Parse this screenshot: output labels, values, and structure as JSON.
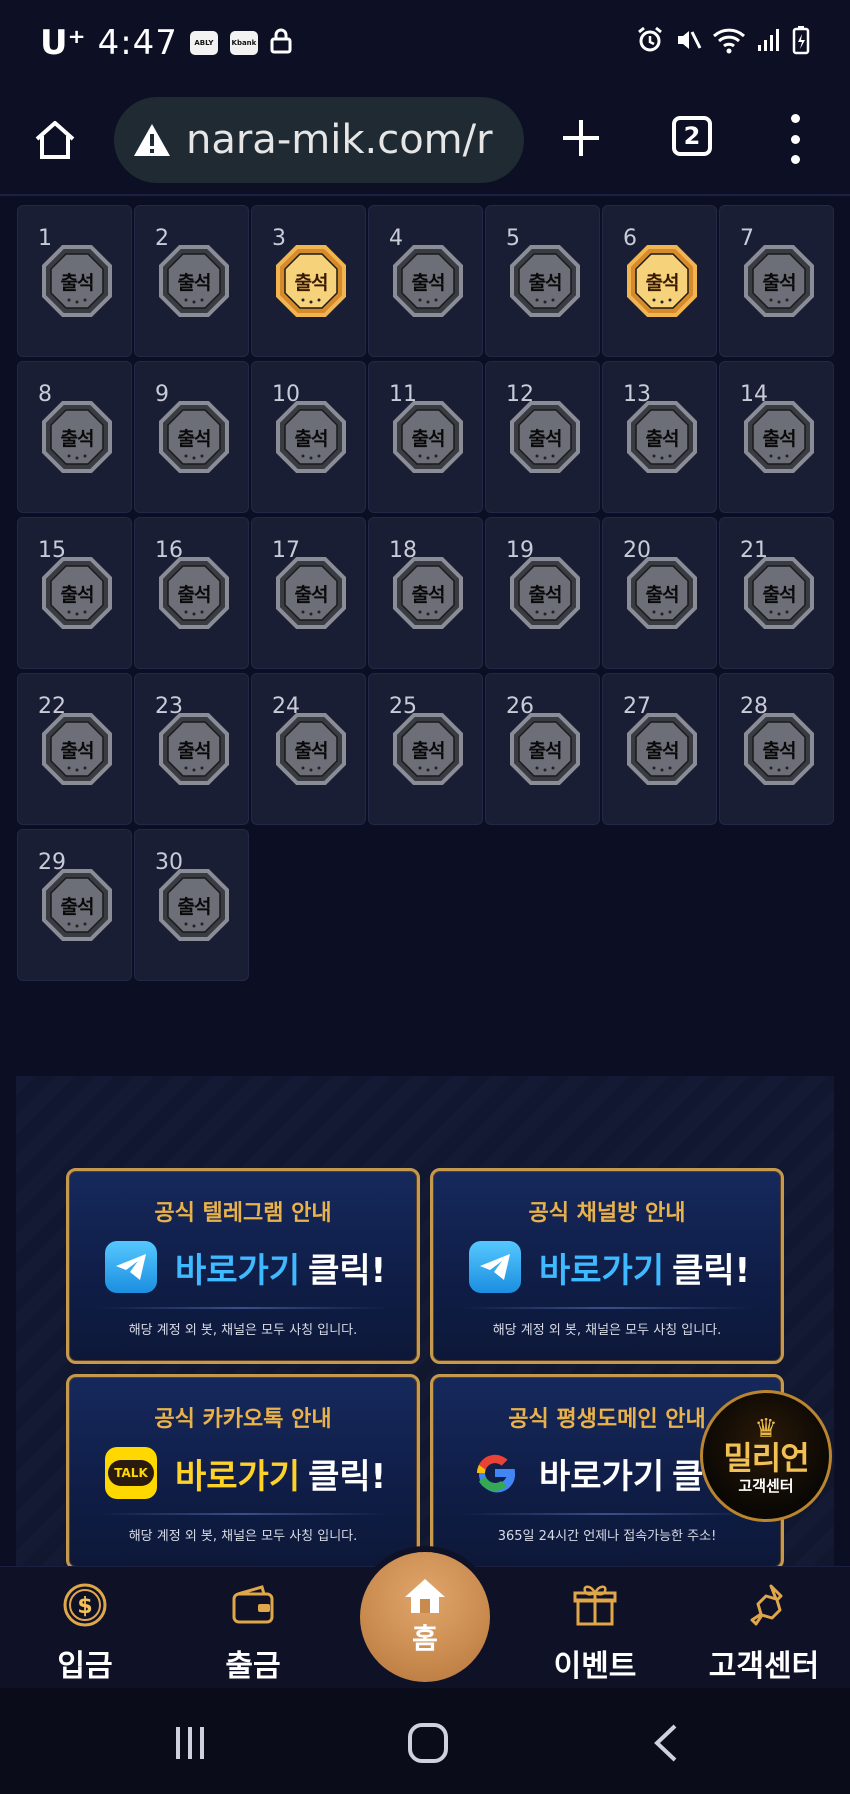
{
  "status_bar": {
    "carrier": "U⁺",
    "time": "4:47",
    "app_badges": [
      "ABLY",
      "Kbank"
    ]
  },
  "browser": {
    "url": "nara-mik.com/r",
    "tab_count": "2"
  },
  "calendar": {
    "badge_label": "출석",
    "days": [
      {
        "day": "1",
        "checked": false
      },
      {
        "day": "2",
        "checked": false
      },
      {
        "day": "3",
        "checked": true
      },
      {
        "day": "4",
        "checked": false
      },
      {
        "day": "5",
        "checked": false
      },
      {
        "day": "6",
        "checked": true
      },
      {
        "day": "7",
        "checked": false
      },
      {
        "day": "8",
        "checked": false
      },
      {
        "day": "9",
        "checked": false
      },
      {
        "day": "10",
        "checked": false
      },
      {
        "day": "11",
        "checked": false
      },
      {
        "day": "12",
        "checked": false
      },
      {
        "day": "13",
        "checked": false
      },
      {
        "day": "14",
        "checked": false
      },
      {
        "day": "15",
        "checked": false
      },
      {
        "day": "16",
        "checked": false
      },
      {
        "day": "17",
        "checked": false
      },
      {
        "day": "18",
        "checked": false
      },
      {
        "day": "19",
        "checked": false
      },
      {
        "day": "20",
        "checked": false
      },
      {
        "day": "21",
        "checked": false
      },
      {
        "day": "22",
        "checked": false
      },
      {
        "day": "23",
        "checked": false
      },
      {
        "day": "24",
        "checked": false
      },
      {
        "day": "25",
        "checked": false
      },
      {
        "day": "26",
        "checked": false
      },
      {
        "day": "27",
        "checked": false
      },
      {
        "day": "28",
        "checked": false
      },
      {
        "day": "29",
        "checked": false
      },
      {
        "day": "30",
        "checked": false
      }
    ]
  },
  "promo": {
    "cards": [
      {
        "title": "공식 텔레그램 안내",
        "go": "바로가기",
        "click": "클릭!",
        "desc": "해당 계정 외 봇, 채널은 모두 사칭 입니다.",
        "icon": "telegram-icon"
      },
      {
        "title": "공식 채널방 안내",
        "go": "바로가기",
        "click": "클릭!",
        "desc": "해당 계정 외 봇, 채널은 모두 사칭 입니다.",
        "icon": "telegram-icon"
      },
      {
        "title": "공식 카카오톡 안내",
        "go": "바로가기",
        "click": "클릭!",
        "desc": "해당 계정 외 봇, 채널은 모두 사칭 입니다.",
        "icon": "kakaotalk-icon",
        "icon_text": "TALK"
      },
      {
        "title": "공식 평생도메인 안내",
        "go": "바로가기",
        "click": "클",
        "desc": "365일 24시간 언제나 접속가능한 주소!",
        "icon": "google-icon",
        "icon_text": "G"
      }
    ]
  },
  "customer_center_float": {
    "title": "밀리언",
    "subtitle": "고객센터"
  },
  "bottom_nav": {
    "deposit": "입금",
    "withdraw": "출금",
    "home": "홈",
    "event": "이벤트",
    "support": "고객센터"
  },
  "colors": {
    "background": "#0c0f24",
    "cell": "#1a1e34",
    "gold": "#c59a4e",
    "accent_blue": "#3fb9ff",
    "accent_yellow": "#ffd22a",
    "home_button": "#c98a4e"
  }
}
